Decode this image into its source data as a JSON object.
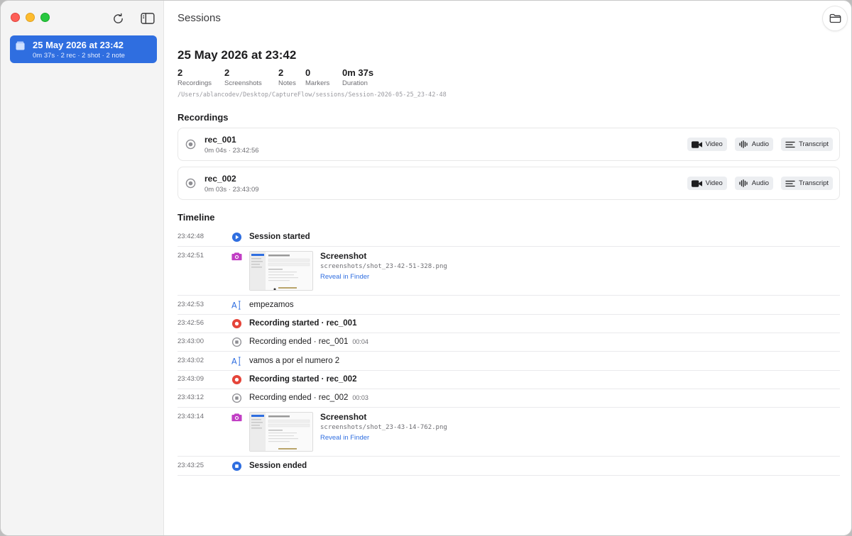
{
  "sidebar": {
    "session": {
      "title": "25 May 2026 at 23:42",
      "subtitle": "0m 37s · 2 rec · 2 shot · 2 note"
    }
  },
  "header": {
    "title": "Sessions"
  },
  "session": {
    "title": "25 May 2026 at 23:42",
    "stats": [
      {
        "value": "2",
        "label": "Recordings"
      },
      {
        "value": "2",
        "label": "Screenshots"
      },
      {
        "value": "2",
        "label": "Notes"
      },
      {
        "value": "0",
        "label": "Markers"
      },
      {
        "value": "0m 37s",
        "label": "Duration"
      }
    ],
    "path": "/Users/ablancodev/Desktop/CaptureFlow/sessions/Session-2026-05-25_23-42-48"
  },
  "recordings": {
    "heading": "Recordings",
    "items": [
      {
        "name": "rec_001",
        "meta": "0m 04s · 23:42:56"
      },
      {
        "name": "rec_002",
        "meta": "0m 03s · 23:43:09"
      }
    ],
    "actions": {
      "video": "Video",
      "audio": "Audio",
      "transcript": "Transcript"
    }
  },
  "timeline": {
    "heading": "Timeline",
    "events": [
      {
        "time": "23:42:48",
        "text": "Session started"
      },
      {
        "time": "23:42:51",
        "title": "Screenshot",
        "file": "screenshots/shot_23-42-51-328.png",
        "link": "Reveal in Finder"
      },
      {
        "time": "23:42:53",
        "text": "empezamos"
      },
      {
        "time": "23:42:56",
        "text": "Recording started · rec_001"
      },
      {
        "time": "23:43:00",
        "text": "Recording ended · rec_001",
        "duration": "00:04"
      },
      {
        "time": "23:43:02",
        "text": "vamos a por el numero 2"
      },
      {
        "time": "23:43:09",
        "text": "Recording started · rec_002"
      },
      {
        "time": "23:43:12",
        "text": "Recording ended · rec_002",
        "duration": "00:03"
      },
      {
        "time": "23:43:14",
        "title": "Screenshot",
        "file": "screenshots/shot_23-43-14-762.png",
        "link": "Reveal in Finder"
      },
      {
        "time": "23:43:25",
        "text": "Session ended"
      }
    ]
  },
  "colors": {
    "accent": "#2f6ee0",
    "record": "#e5453a",
    "screenshot": "#c13ec4",
    "note": "#2f6ee0",
    "stopped": "#8e8e93"
  },
  "icons": {
    "session_start": "play-circle-icon",
    "screenshot": "camera-icon",
    "note": "text-cursor-icon",
    "recording_start": "record-circle-icon",
    "recording_end": "stop-circle-icon",
    "session_end": "stop-circle-icon"
  }
}
